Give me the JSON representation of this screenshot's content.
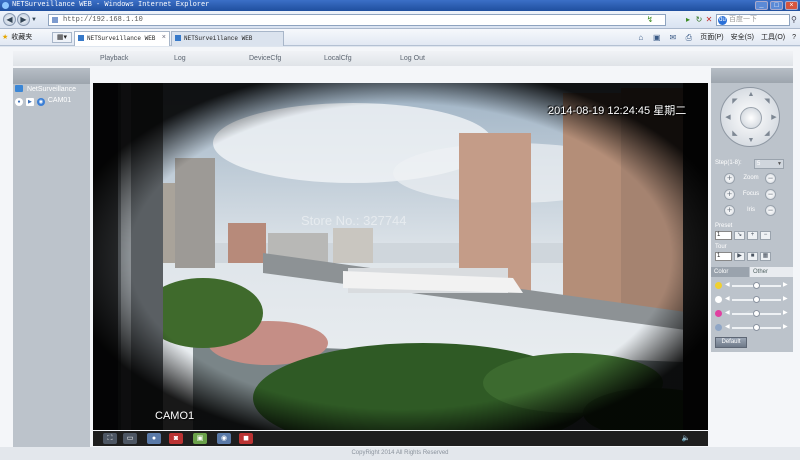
{
  "window": {
    "title": "NETSurveillance WEB - Windows Internet Explorer",
    "controls": [
      "_",
      "□",
      "×"
    ]
  },
  "address": {
    "url": "http://192.168.1.10",
    "search_placeholder": "百度一下"
  },
  "favbar": {
    "favorites_label": "收藏夹",
    "tabs": [
      {
        "label": "NETSurveillance WEB"
      },
      {
        "label": "NETSurveillance WEB"
      }
    ],
    "commands": {
      "page": "页面(P)",
      "safety": "安全(S)",
      "tools": "工具(O)",
      "help": "?"
    }
  },
  "nav": {
    "items": [
      "Playback",
      "Log",
      "DeviceCfg",
      "LocalCfg",
      "Log Out"
    ]
  },
  "tree": {
    "root": "NetSurveillance",
    "camera": "CAM01"
  },
  "video": {
    "timestamp": "2014-08-19 12:24:45 星期二",
    "camera_label": "CAMO1",
    "watermark": "Store No.: 327744"
  },
  "ptz": {
    "step_label": "Step(1-8):",
    "step_value": "5",
    "zoom_label": "Zoom",
    "focus_label": "Focus",
    "iris_label": "Iris",
    "preset_label": "Preset",
    "preset_value": "1",
    "tour_label": "Tour",
    "tour_value": "1"
  },
  "color": {
    "tab_color": "Color",
    "tab_other": "Other",
    "sliders": [
      {
        "name": "brightness",
        "value": 0.5,
        "color": "#f0d030"
      },
      {
        "name": "contrast",
        "value": 0.5,
        "color": "#ffffff"
      },
      {
        "name": "saturation",
        "value": 0.5,
        "color": "#e040a0"
      },
      {
        "name": "hue",
        "value": 0.5,
        "color": "#8fa6c6"
      }
    ],
    "default_label": "Default"
  },
  "footer": {
    "copyright": "CopyRight 2014 All Rights Reserved"
  }
}
